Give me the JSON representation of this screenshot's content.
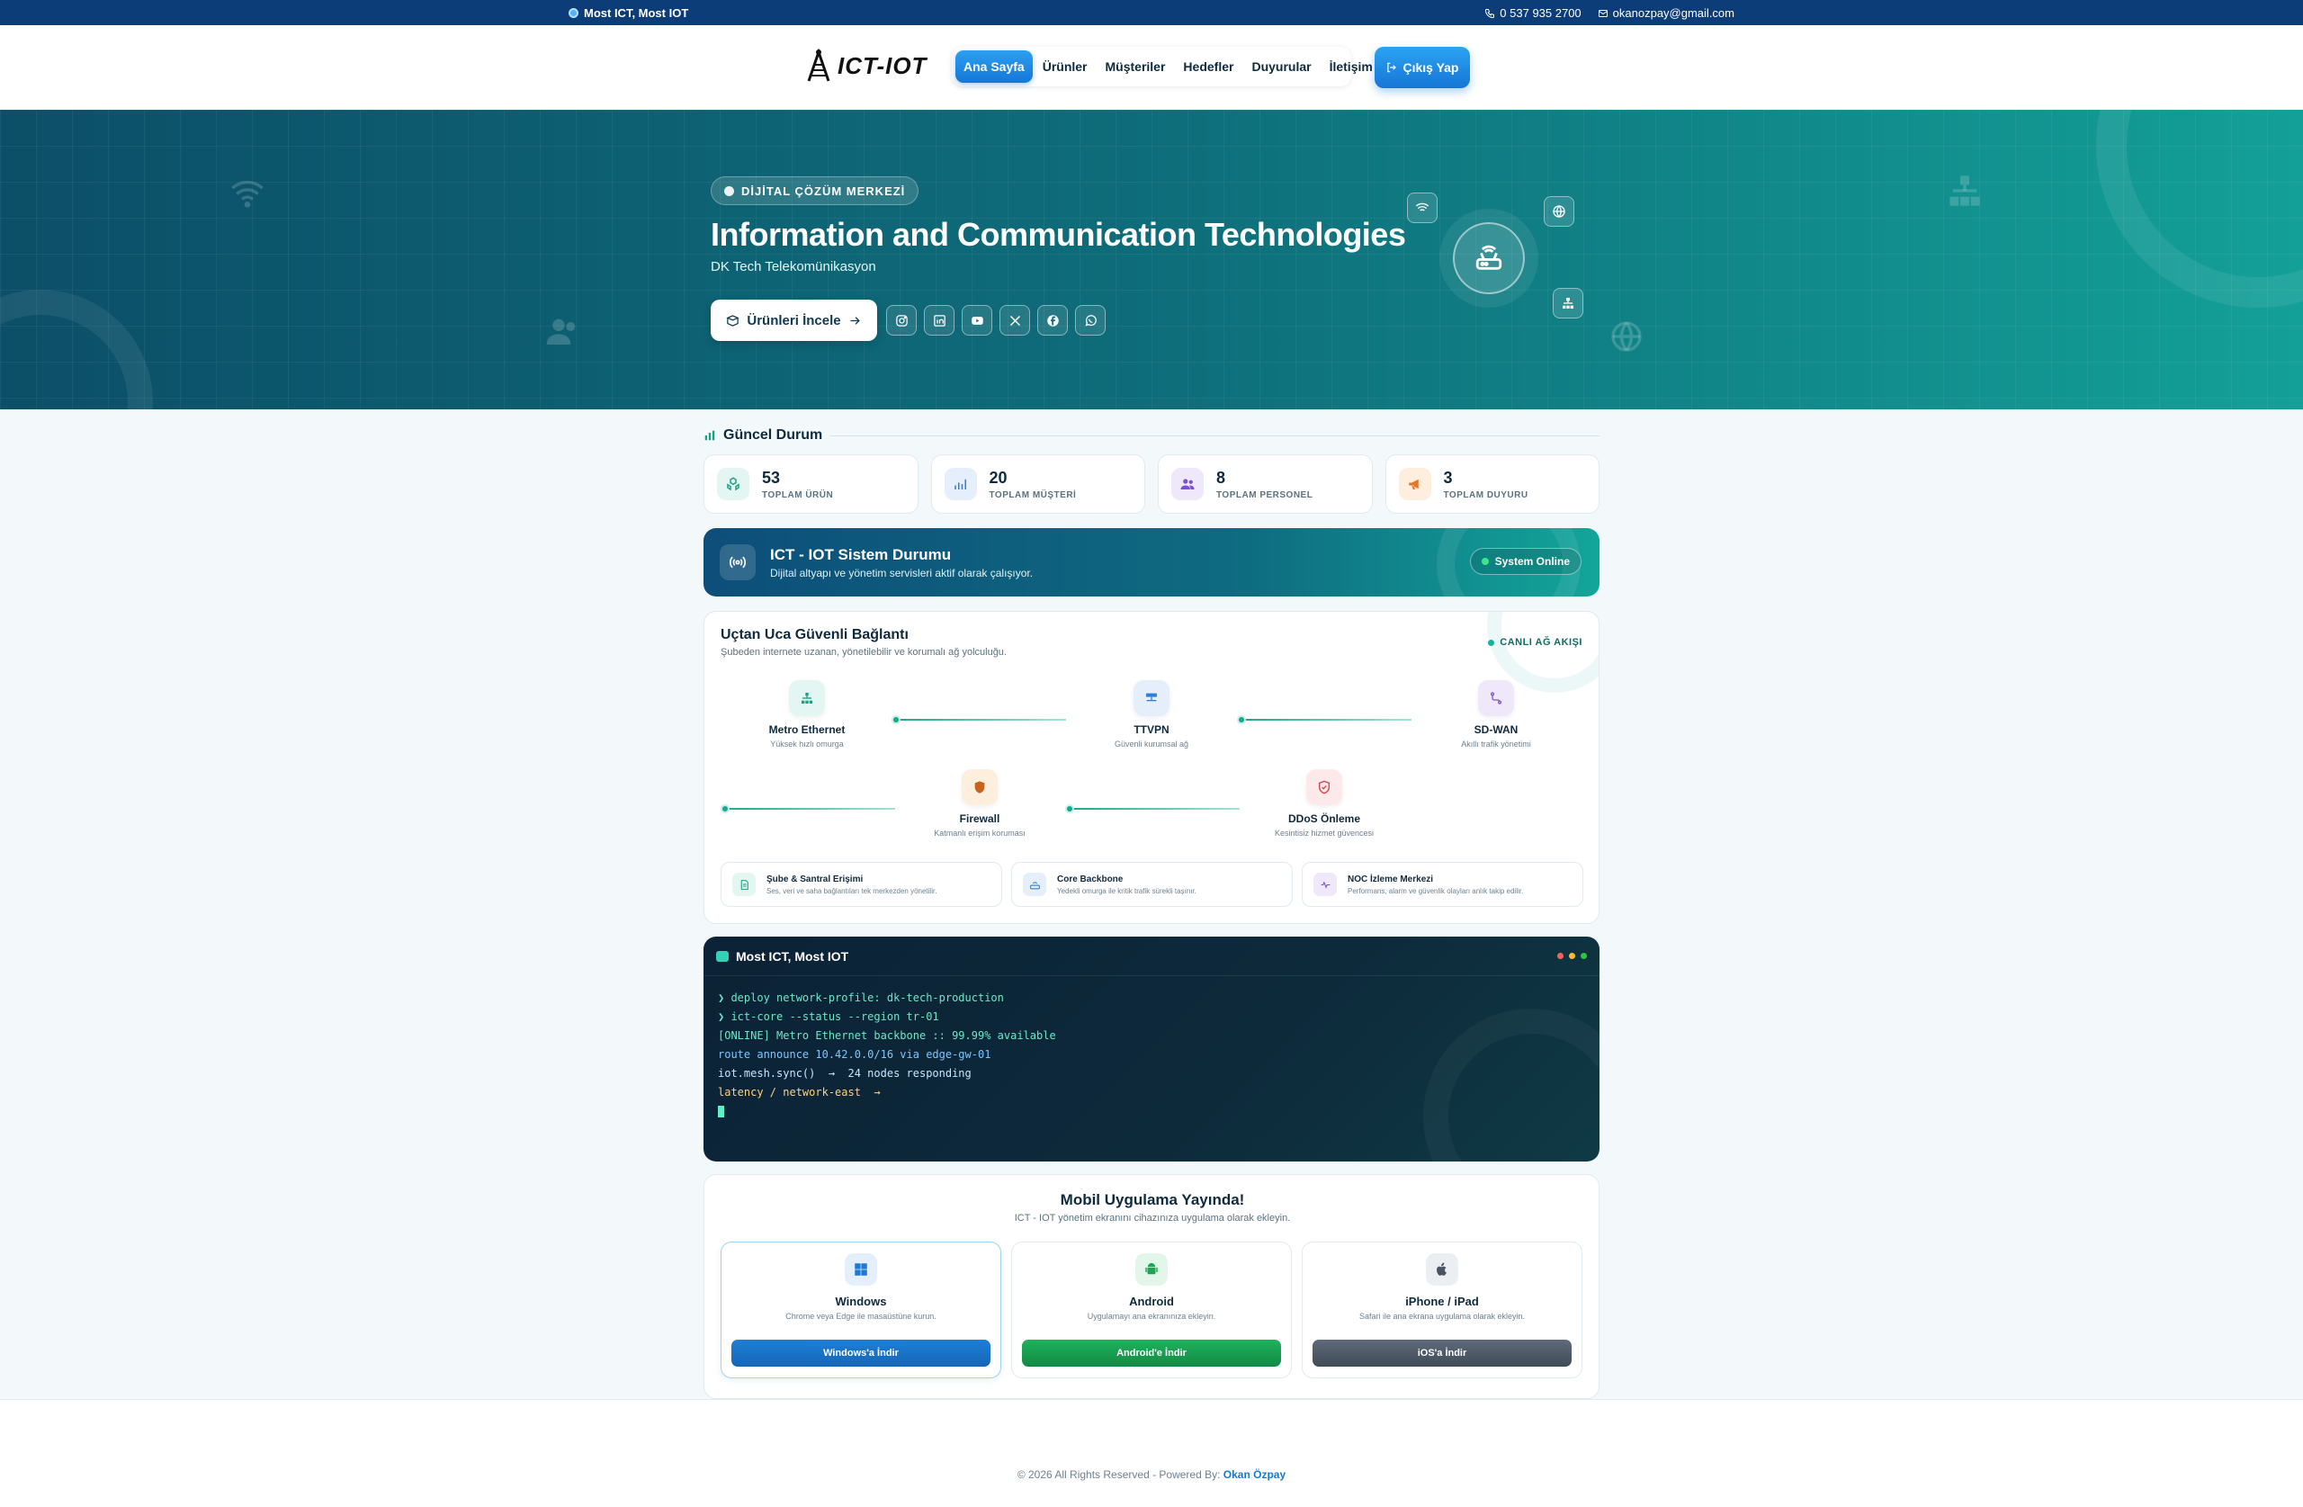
{
  "topbar": {
    "brand": "Most ICT, Most IOT",
    "phone": "0 537 935 2700",
    "email": "okanozpay@gmail.com"
  },
  "navbar": {
    "logo_text": "ICT-IOT",
    "items": [
      "Ana Sayfa",
      "Ürünler",
      "Müşteriler",
      "Hedefler",
      "Duyurular",
      "İletişim"
    ],
    "active": "Ana Sayfa",
    "logout_label": "Çıkış Yap"
  },
  "hero": {
    "badge": "DİJİTAL ÇÖZÜM MERKEZİ",
    "title": "Information and Communication Technologies",
    "subtitle": "DK Tech Telekomünikasyon",
    "cta": "Ürünleri İncele",
    "socials": [
      "instagram-icon",
      "linkedin-icon",
      "youtube-icon",
      "x-icon",
      "facebook-icon",
      "whatsapp-icon"
    ]
  },
  "current_status": {
    "title": "Güncel Durum",
    "stats": [
      {
        "value": "53",
        "label": "TOPLAM ÜRÜN",
        "color": "#1aa085"
      },
      {
        "value": "20",
        "label": "TOPLAM MÜŞTERİ",
        "color": "#2f7fd6"
      },
      {
        "value": "8",
        "label": "TOPLAM PERSONEL",
        "color": "#7c4fd6"
      },
      {
        "value": "3",
        "label": "TOPLAM DUYURU",
        "color": "#e0782a"
      }
    ]
  },
  "system_status": {
    "title": "ICT - IOT Sistem Durumu",
    "desc": "Dijital altyapı ve yönetim servisleri aktif olarak çalışıyor.",
    "badge": "System Online"
  },
  "connection": {
    "title": "Uçtan Uca Güvenli Bağlantı",
    "desc": "Şubeden internete uzanan, yönetilebilir ve korumalı ağ yolculuğu.",
    "live": "CANLI AĞ AKIŞI",
    "nodes": [
      {
        "title": "Metro Ethernet",
        "sub": "Yüksek hızlı omurga"
      },
      {
        "title": "TTVPN",
        "sub": "Güvenli kurumsal ağ"
      },
      {
        "title": "SD-WAN",
        "sub": "Akıllı trafik yönetimi"
      },
      {
        "title": "Firewall",
        "sub": "Katmanlı erişim koruması"
      },
      {
        "title": "DDoS Önleme",
        "sub": "Kesintisiz hizmet güvencesi"
      }
    ],
    "features": [
      {
        "title": "Şube & Santral Erişimi",
        "sub": "Ses, veri ve saha bağlantıları tek merkezden yönetilir."
      },
      {
        "title": "Core Backbone",
        "sub": "Yedekli omurga ile kritik trafik sürekli taşınır."
      },
      {
        "title": "NOC İzleme Merkezi",
        "sub": "Performans, alarm ve güvenlik olayları anlık takip edilir."
      }
    ]
  },
  "terminal": {
    "title": "Most ICT, Most IOT",
    "lines": [
      "❯ deploy network-profile: dk-tech-production",
      "❯ ict-core --status --region tr-01",
      "[ONLINE] Metro Ethernet backbone :: 99.99% available",
      "route announce 10.42.0.0/16 via edge-gw-01",
      "iot.mesh.sync()  →  24 nodes responding",
      "latency / network-east  →"
    ]
  },
  "mobile": {
    "title": "Mobil Uygulama Yayında!",
    "desc": "ICT - IOT yönetim ekranını cihazınıza uygulama olarak ekleyin.",
    "apps": [
      {
        "title": "Windows",
        "sub": "Chrome veya Edge ile masaüstüne kurun.",
        "button": "Windows'a İndir"
      },
      {
        "title": "Android",
        "sub": "Uygulamayı ana ekranınıza ekleyin.",
        "button": "Android'e İndir"
      },
      {
        "title": "iPhone / iPad",
        "sub": "Safari ile ana ekrana uygulama olarak ekleyin.",
        "button": "iOS'a İndir"
      }
    ]
  },
  "footer": {
    "text": "© 2026 All Rights Reserved - Powered By:",
    "author": "Okan Özpay"
  }
}
